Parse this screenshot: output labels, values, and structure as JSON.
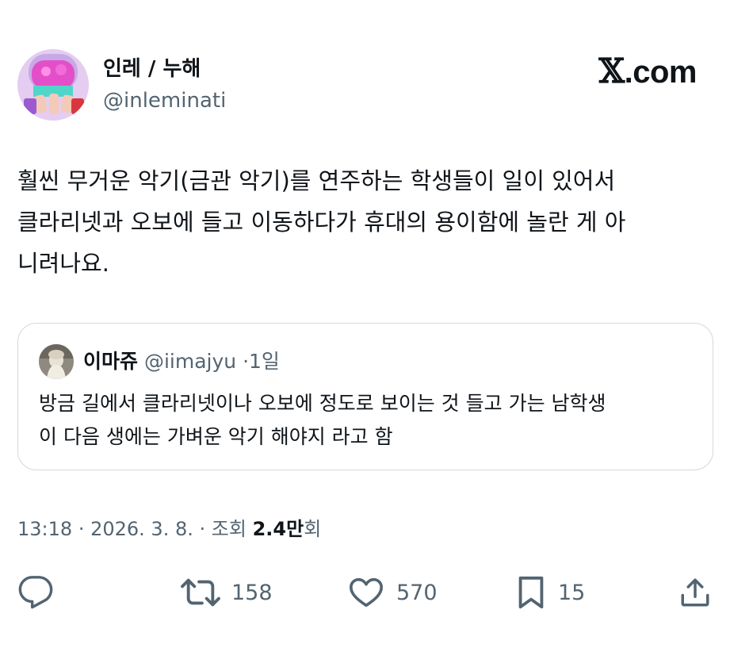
{
  "author": {
    "display_name": "인레 / 누해",
    "handle": "@inleminati",
    "avatar_icon": "avatar-illustration"
  },
  "brand": {
    "x_glyph": "𝕏",
    "domain_suffix": ".com"
  },
  "tweet": {
    "lines": [
      "훨씬 무거운 악기(금관 악기)를 연주하는 학생들이 일이 있어서",
      "클라리넷과 오보에 들고 이동하다가 휴대의 용이함에 놀란 게 아",
      "니려나요."
    ]
  },
  "quote": {
    "name": "이마쥬",
    "handle": "@iimajyu",
    "separator": "·",
    "time": "1일",
    "avatar_icon": "avatar-photo",
    "lines": [
      "방금 길에서 클라리넷이나 오보에 정도로 보이는 것 들고 가는 남학생",
      "이 다음 생에는 가벼운 악기 해야지 라고 함"
    ]
  },
  "meta": {
    "time": "13:18",
    "sep1": "·",
    "date": "2026. 3. 8.",
    "sep2": "·",
    "views_label": "조회",
    "views_count": "2.4만",
    "views_suffix": "회"
  },
  "actions": {
    "reply_icon": "reply-icon",
    "retweet_icon": "retweet-icon",
    "retweets": "158",
    "like_icon": "like-icon",
    "likes": "570",
    "bookmark_icon": "bookmark-icon",
    "bookmarks": "15",
    "share_icon": "share-icon"
  },
  "colors": {
    "text": "#0f1419",
    "secondary": "#536471",
    "border": "#cfd9de",
    "avatar_bg": "#e4cdf0"
  }
}
